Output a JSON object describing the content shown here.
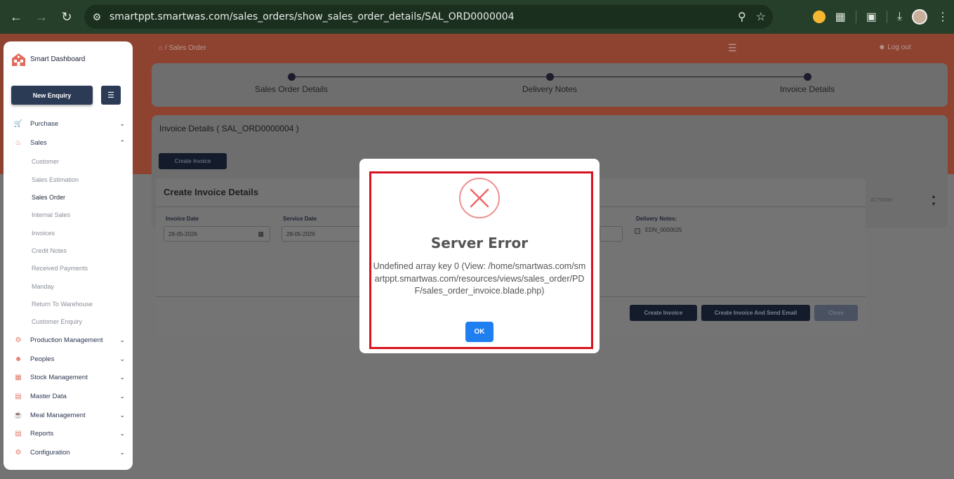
{
  "browser": {
    "url": "smartppt.smartwas.com/sales_orders/show_sales_order_details/SAL_ORD0000004"
  },
  "header": {
    "breadcrumb_separator": "/",
    "breadcrumb_current": "Sales Order",
    "logout": "Log out"
  },
  "stepper": {
    "steps": [
      "Sales Order Details",
      "Delivery Notes",
      "Invoice Details"
    ]
  },
  "invoice_section": {
    "title": "Invoice Details ( SAL_ORD0000004 )",
    "create_button": "Create Invoice",
    "actions_header": "ACTIONS"
  },
  "create_modal": {
    "title": "Create Invoice Details",
    "invoice_date_label": "Invoice Date",
    "invoice_date_value": "28-05-2026",
    "service_date_label": "Service Date",
    "service_date_value": "28-05-2026",
    "delivery_notes_label": "Delivery Notes:",
    "delivery_note_item": "EDN_0000025",
    "btn_create": "Create Invoice",
    "btn_create_email": "Create Invoice And Send Email",
    "btn_close": "Close"
  },
  "sidebar": {
    "brand": "Smart Dashboard",
    "new_enquiry": "New Enquiry",
    "items": [
      {
        "label": "Purchase",
        "icon": "cart-icon"
      },
      {
        "label": "Sales",
        "icon": "sales-icon"
      },
      {
        "label": "Production Management",
        "icon": "production-icon"
      },
      {
        "label": "Peoples",
        "icon": "people-icon"
      },
      {
        "label": "Stock Management",
        "icon": "stock-icon"
      },
      {
        "label": "Master Data",
        "icon": "database-icon"
      },
      {
        "label": "Meal Management",
        "icon": "meal-icon"
      },
      {
        "label": "Reports",
        "icon": "reports-icon"
      },
      {
        "label": "Configuration",
        "icon": "config-icon"
      }
    ],
    "sales_sub": [
      "Customer",
      "Sales Estimation",
      "Sales Order",
      "Internal Sales",
      "Invoices",
      "Credit Notes",
      "Received Payments",
      "Manday",
      "Return To Warehouse",
      "Customer Enquiry"
    ]
  },
  "dialog": {
    "title": "Server Error",
    "message": "Undefined array key 0 (View: /home/smartwas.com/smartppt.smartwas.com/resources/views/sales_order/PDF/sales_order_invoice.blade.php)",
    "ok": "OK"
  },
  "colors": {
    "browser_bar": "#253f2a",
    "banner": "#8e4331",
    "sidebar_button": "#2b3a55",
    "error_red": "#d6141e",
    "ok_button": "#1f7ef0"
  }
}
